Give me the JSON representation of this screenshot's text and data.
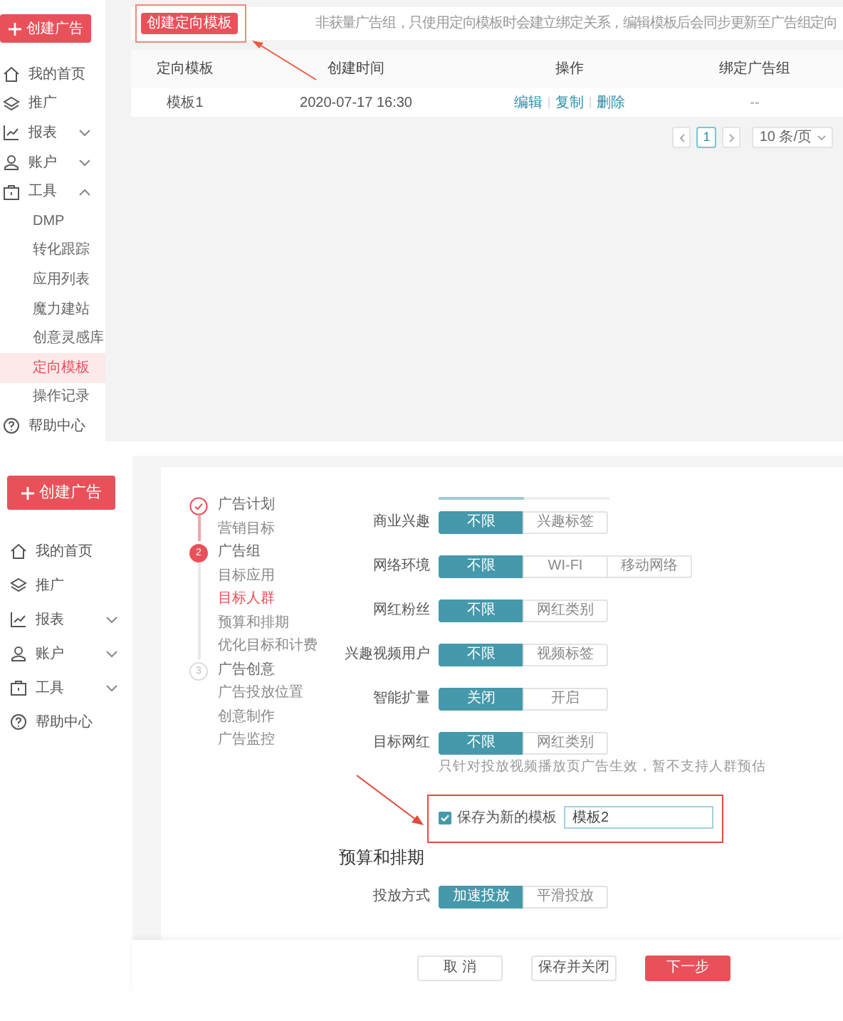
{
  "template_list": {
    "sidebar": {
      "create_button": "创建广告",
      "items": [
        {
          "label": "我的首页",
          "selected": false
        },
        {
          "label": "推广",
          "selected": false
        },
        {
          "label": "报表",
          "selected": false,
          "expanded": false
        },
        {
          "label": "账户",
          "selected": false,
          "expanded": false
        },
        {
          "label": "工具",
          "selected": false,
          "expanded": true,
          "children": [
            {
              "label": "DMP",
              "selected": false
            },
            {
              "label": "转化跟踪",
              "selected": false
            },
            {
              "label": "应用列表",
              "selected": false
            },
            {
              "label": "魔力建站",
              "selected": false
            },
            {
              "label": "创意灵感库",
              "selected": false
            },
            {
              "label": "定向模板",
              "selected": true
            },
            {
              "label": "操作记录",
              "selected": false
            }
          ]
        },
        {
          "label": "帮助中心",
          "selected": false
        }
      ]
    },
    "create_template_button": "创建定向模板",
    "notice": "非获量广告组，只使用定向模板时会建立绑定关系，编辑模板后会同步更新至广告组定向",
    "table": {
      "columns": [
        "定向模板",
        "创建时间",
        "操作",
        "绑定广告组"
      ],
      "rows": [
        {
          "template": "模板1",
          "created": "2020-07-17 16:30",
          "actions": [
            "编辑",
            "复制",
            "删除"
          ],
          "bound_ad_group": "--"
        }
      ]
    },
    "pagination": {
      "pages": [
        {
          "label": "1",
          "selected": true
        }
      ],
      "page_size": "10 条/页"
    }
  },
  "ad_group_editor": {
    "sidebar": {
      "create_button": "创建广告",
      "items": [
        {
          "label": "我的首页",
          "selected": false
        },
        {
          "label": "推广",
          "selected": false
        },
        {
          "label": "报表",
          "selected": false,
          "expanded": false
        },
        {
          "label": "账户",
          "selected": false,
          "expanded": false
        },
        {
          "label": "工具",
          "selected": false,
          "expanded": false
        },
        {
          "label": "帮助中心",
          "selected": false
        }
      ]
    },
    "steps": [
      {
        "completed": true,
        "active": false,
        "label": "广告计划",
        "substeps": [
          {
            "label": "营销目标",
            "selected": false
          }
        ]
      },
      {
        "completed": false,
        "active": true,
        "number": "2",
        "label": "广告组",
        "substeps": [
          {
            "label": "目标应用",
            "selected": false
          },
          {
            "label": "目标人群",
            "selected": true
          },
          {
            "label": "预算和排期",
            "selected": false
          },
          {
            "label": "优化目标和计费",
            "selected": false
          }
        ]
      },
      {
        "completed": false,
        "active": false,
        "number": "3",
        "label": "广告创意",
        "substeps": [
          {
            "label": "广告投放位置",
            "selected": false
          },
          {
            "label": "创意制作",
            "selected": false
          },
          {
            "label": "广告监控",
            "selected": false
          }
        ]
      }
    ],
    "targeting_rows": [
      {
        "label": "商业兴趣",
        "options": [
          {
            "label": "不限",
            "selected": true
          },
          {
            "label": "兴趣标签",
            "selected": false
          }
        ]
      },
      {
        "label": "网络环境",
        "options": [
          {
            "label": "不限",
            "selected": true
          },
          {
            "label": "WI-FI",
            "selected": false
          },
          {
            "label": "移动网络",
            "selected": false
          }
        ]
      },
      {
        "label": "网红粉丝",
        "options": [
          {
            "label": "不限",
            "selected": true
          },
          {
            "label": "网红类别",
            "selected": false
          }
        ]
      },
      {
        "label": "兴趣视频用户",
        "options": [
          {
            "label": "不限",
            "selected": true
          },
          {
            "label": "视频标签",
            "selected": false
          }
        ]
      },
      {
        "label": "智能扩量",
        "options": [
          {
            "label": "关闭",
            "selected": true
          },
          {
            "label": "开启",
            "selected": false
          }
        ]
      },
      {
        "label": "目标网红",
        "options": [
          {
            "label": "不限",
            "selected": true
          },
          {
            "label": "网红类别",
            "selected": false
          }
        ],
        "hint": "只针对投放视频播放页广告生效，暂不支持人群预估"
      }
    ],
    "save_template": {
      "label": "保存为新的模板",
      "checked": true,
      "value": "模板2"
    },
    "budget_section": {
      "title": "预算和排期",
      "rows": [
        {
          "label": "投放方式",
          "options": [
            {
              "label": "加速投放",
              "selected": true
            },
            {
              "label": "平滑投放",
              "selected": false
            }
          ]
        }
      ]
    },
    "footer_buttons": [
      {
        "label": "取 消",
        "kind": "default"
      },
      {
        "label": "保存并关闭",
        "kind": "default"
      },
      {
        "label": "下一步",
        "kind": "primary"
      }
    ]
  }
}
